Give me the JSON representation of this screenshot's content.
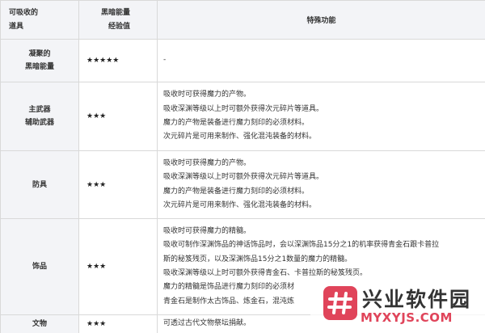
{
  "headers": {
    "item": [
      "可吸收的",
      "道具"
    ],
    "exp": [
      "黑暗能量",
      "经验值"
    ],
    "feature": "特殊功能"
  },
  "rows": [
    {
      "name": [
        "凝聚的",
        "黑暗能量"
      ],
      "stars": "★★★★★",
      "desc": [
        "-"
      ]
    },
    {
      "name": [
        "主武器",
        "辅助武器"
      ],
      "stars": "★★★",
      "desc": [
        "吸收时可获得魔力的产物。",
        "吸收深渊等级以上时可额外获得次元碎片等道具。",
        "魔力的产物是装备进行魔力刻印的必须材料。",
        "次元碎片是可用来制作、强化混沌装备的材料。"
      ]
    },
    {
      "name": [
        "防具"
      ],
      "stars": "★★★",
      "desc": [
        "吸收时可获得魔力的产物。",
        "吸收深渊等级以上时可额外获得次元碎片等道具。",
        "魔力的产物是装备进行魔力刻印的必须材料。",
        "次元碎片是可用来制作、强化混沌装备的材料。"
      ]
    },
    {
      "name": [
        "饰品"
      ],
      "stars": "★★★",
      "desc": [
        "吸收时可获得魔力的精髓。",
        "吸收可制作深渊饰品的神话饰品时，会以深渊饰品15分之1的机率获得青金石跟卡普拉",
        "斯的秘笈残页，以及深渊饰品15分之1数量的魔力的精髓。",
        "吸收深渊等级以上时可额外获得青金石、卡普拉斯的秘笈残页。",
        "魔力的精髓是饰品进行魔力刻印的必须材",
        "青金石是制作太古饰品、炼金石，混沌炼"
      ]
    },
    {
      "name": [
        "文物"
      ],
      "stars": "★★★",
      "desc": [
        "可透过古代文物祭坛捐献。"
      ]
    }
  ],
  "watermark": {
    "title": "兴业软件园",
    "url": "MYXYJS.COM",
    "brand_color": "#e0445a"
  }
}
